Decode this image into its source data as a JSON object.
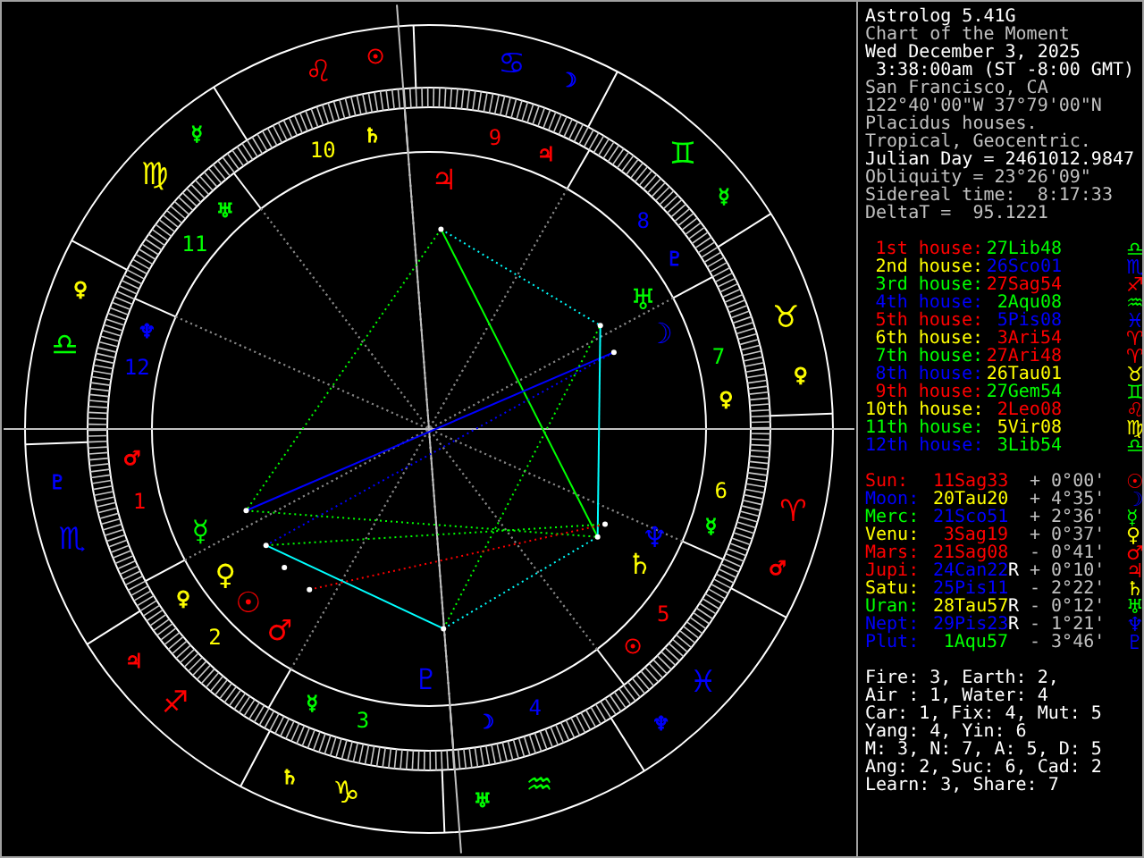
{
  "wheel": {
    "signs": [
      {
        "kind": "leo",
        "glyph": "♌",
        "color": "#ff0000",
        "ruler": {
          "glyph": "☉",
          "color": "#ff0000"
        }
      },
      {
        "kind": "cancer",
        "glyph": "♋",
        "color": "#0000ff",
        "ruler": {
          "glyph": "☽",
          "color": "#0000ff"
        }
      },
      {
        "kind": "virgo",
        "glyph": "♍",
        "color": "#ffff00",
        "ruler": {
          "glyph": "☿",
          "color": "#00ff00"
        }
      },
      {
        "kind": "gemini",
        "glyph": "♊",
        "color": "#00ff00",
        "ruler": {
          "glyph": "☿",
          "color": "#00ff00"
        }
      },
      {
        "kind": "libra",
        "glyph": "♎",
        "color": "#00ff00",
        "ruler": {
          "glyph": "♀",
          "color": "#ffff00"
        }
      },
      {
        "kind": "taurus",
        "glyph": "♉",
        "color": "#ffff00",
        "ruler": {
          "glyph": "♀",
          "color": "#ffff00"
        }
      },
      {
        "kind": "scorpio",
        "glyph": "♏",
        "color": "#0000ff",
        "ruler": {
          "glyph": "♇",
          "color": "#0000ff"
        }
      },
      {
        "kind": "aries",
        "glyph": "♈",
        "color": "#ff0000",
        "ruler": {
          "glyph": "♂",
          "color": "#ff0000"
        }
      },
      {
        "kind": "sagittarius",
        "glyph": "♐",
        "color": "#ff0000",
        "ruler": {
          "glyph": "♃",
          "color": "#ff0000"
        }
      },
      {
        "kind": "pisces",
        "glyph": "♓",
        "color": "#0000ff",
        "ruler": {
          "glyph": "♆",
          "color": "#0000ff"
        }
      },
      {
        "kind": "capricorn",
        "glyph": "♑",
        "color": "#ffff00",
        "ruler": {
          "glyph": "♄",
          "color": "#ffff00"
        }
      },
      {
        "kind": "aquarius",
        "glyph": "♒",
        "color": "#00ff00",
        "ruler": {
          "glyph": "♅",
          "color": "#00ff00"
        }
      }
    ],
    "houses": [
      {
        "kind": "tenth",
        "number": "10",
        "color": "#ffff00",
        "ruler": {
          "glyph": "♄",
          "color": "#ffff00"
        }
      },
      {
        "kind": "ninth",
        "number": "9",
        "color": "#ff0000",
        "ruler": {
          "glyph": "♃",
          "color": "#ff0000"
        }
      },
      {
        "kind": "eleventh",
        "number": "11",
        "color": "#00ff00",
        "ruler": {
          "glyph": "♅",
          "color": "#00ff00"
        }
      },
      {
        "kind": "eighth",
        "number": "8",
        "color": "#0000ff",
        "ruler": {
          "glyph": "♇",
          "color": "#0000ff"
        }
      },
      {
        "kind": "twelfth",
        "number": "12",
        "color": "#0000ff",
        "ruler": {
          "glyph": "♆",
          "color": "#0000ff"
        }
      },
      {
        "kind": "seventh",
        "number": "7",
        "color": "#00ff00",
        "ruler": {
          "glyph": "♀",
          "color": "#ffff00"
        }
      },
      {
        "kind": "first",
        "number": "1",
        "color": "#ff0000",
        "ruler": {
          "glyph": "♂",
          "color": "#ff0000"
        }
      },
      {
        "kind": "sixth",
        "number": "6",
        "color": "#ffff00",
        "ruler": {
          "glyph": "☿",
          "color": "#00ff00"
        }
      },
      {
        "kind": "second",
        "number": "2",
        "color": "#ffff00",
        "ruler": {
          "glyph": "♀",
          "color": "#ffff00"
        }
      },
      {
        "kind": "fifth",
        "number": "5",
        "color": "#ff0000",
        "ruler": {
          "glyph": "☉",
          "color": "#ff0000"
        }
      },
      {
        "kind": "third",
        "number": "3",
        "color": "#00ff00",
        "ruler": {
          "glyph": "☿",
          "color": "#00ff00"
        }
      },
      {
        "kind": "fourth",
        "number": "4",
        "color": "#0000ff",
        "ruler": {
          "glyph": "☽",
          "color": "#0000ff"
        }
      }
    ],
    "planets": [
      {
        "kind": "jupiter",
        "glyph": "♃",
        "color": "#ff0000"
      },
      {
        "kind": "uranus",
        "glyph": "♅",
        "color": "#00ff00"
      },
      {
        "kind": "moon",
        "glyph": "☽",
        "color": "#0000ff"
      },
      {
        "kind": "mercury",
        "glyph": "☿",
        "color": "#00ff00"
      },
      {
        "kind": "neptune",
        "glyph": "♆",
        "color": "#0000ff"
      },
      {
        "kind": "venus",
        "glyph": "♀",
        "color": "#ffff00"
      },
      {
        "kind": "saturn",
        "glyph": "♄",
        "color": "#ffff00"
      },
      {
        "kind": "sun",
        "glyph": "☉",
        "color": "#ff0000"
      },
      {
        "kind": "mars",
        "glyph": "♂",
        "color": "#ff0000"
      },
      {
        "kind": "pluto",
        "glyph": "♇",
        "color": "#0000ff"
      }
    ]
  },
  "info": [
    {
      "text": "Astrolog 5.41G",
      "color": "#ffffff"
    },
    {
      "text": "Chart of the Moment",
      "color": "#c0c0c0"
    },
    {
      "text": "Wed December 3, 2025",
      "color": "#ffffff"
    },
    {
      "text": " 3:38:00am (ST -8:00 GMT)",
      "color": "#ffffff"
    },
    {
      "text": "San Francisco, CA",
      "color": "#c0c0c0"
    },
    {
      "text": "122°40'00\"W 37°79'00\"N",
      "color": "#c0c0c0"
    },
    {
      "text": "Placidus houses.",
      "color": "#c0c0c0"
    },
    {
      "text": "Tropical, Geocentric.",
      "color": "#c0c0c0"
    },
    {
      "text": "Julian Day = 2461012.9847",
      "color": "#ffffff"
    },
    {
      "text": "Obliquity = 23°26'09\"",
      "color": "#c0c0c0"
    },
    {
      "text": "Sidereal time:  8:17:33",
      "color": "#c0c0c0"
    },
    {
      "text": "DeltaT =  95.1221",
      "color": "#c0c0c0"
    }
  ],
  "houses": [
    {
      "label": "1st house:",
      "color": "#ff0000",
      "cusp": {
        "text": "27Lib48",
        "color": "#00ff00"
      },
      "glyph": "♎"
    },
    {
      "label": "2nd house:",
      "color": "#ffff00",
      "cusp": {
        "text": "26Sco01",
        "color": "#0000ff"
      },
      "glyph": "♏"
    },
    {
      "label": "3rd house:",
      "color": "#00ff00",
      "cusp": {
        "text": "27Sag54",
        "color": "#ff0000"
      },
      "glyph": "♐"
    },
    {
      "label": "4th house:",
      "color": "#0000ff",
      "cusp": {
        "text": "2Aqu08",
        "color": "#00ff00"
      },
      "glyph": "♒"
    },
    {
      "label": "5th house:",
      "color": "#ff0000",
      "cusp": {
        "text": "5Pis08",
        "color": "#0000ff"
      },
      "glyph": "♓"
    },
    {
      "label": "6th house:",
      "color": "#ffff00",
      "cusp": {
        "text": "3Ari54",
        "color": "#ff0000"
      },
      "glyph": "♈"
    },
    {
      "label": "7th house:",
      "color": "#00ff00",
      "cusp": {
        "text": "27Ari48",
        "color": "#ff0000"
      },
      "glyph": "♈"
    },
    {
      "label": "8th house:",
      "color": "#0000ff",
      "cusp": {
        "text": "26Tau01",
        "color": "#ffff00"
      },
      "glyph": "♉"
    },
    {
      "label": "9th house:",
      "color": "#ff0000",
      "cusp": {
        "text": "27Gem54",
        "color": "#00ff00"
      },
      "glyph": "♊"
    },
    {
      "label": "10th house:",
      "color": "#ffff00",
      "cusp": {
        "text": "2Leo08",
        "color": "#ff0000"
      },
      "glyph": "♌"
    },
    {
      "label": "11th house:",
      "color": "#00ff00",
      "cusp": {
        "text": "5Vir08",
        "color": "#ffff00"
      },
      "glyph": "♍"
    },
    {
      "label": "12th house:",
      "color": "#0000ff",
      "cusp": {
        "text": "3Lib54",
        "color": "#00ff00"
      },
      "glyph": "♎"
    }
  ],
  "planets": [
    {
      "name": "Sun:",
      "color": "#ff0000",
      "position": {
        "text": "11Sag33",
        "color": "#ff0000"
      },
      "latitude": "+ 0°00'",
      "glyph": "☉"
    },
    {
      "name": "Moon:",
      "color": "#0000ff",
      "position": {
        "text": "20Tau20",
        "color": "#ffff00"
      },
      "latitude": "+ 4°35'",
      "glyph": "☽"
    },
    {
      "name": "Merc:",
      "color": "#00ff00",
      "position": {
        "text": "21Sco51",
        "color": "#0000ff"
      },
      "latitude": "+ 2°36'",
      "glyph": "☿"
    },
    {
      "name": "Venu:",
      "color": "#ffff00",
      "position": {
        "text": "3Sag19",
        "color": "#ff0000"
      },
      "latitude": "+ 0°37'",
      "glyph": "♀"
    },
    {
      "name": "Mars:",
      "color": "#ff0000",
      "position": {
        "text": "21Sag08",
        "color": "#ff0000"
      },
      "latitude": "- 0°41'",
      "glyph": "♂"
    },
    {
      "name": "Jupi:",
      "color": "#ff0000",
      "position": {
        "text": "24Can22",
        "color": "#0000ff"
      },
      "retrograde_mark": "R",
      "latitude": "+ 0°10'",
      "glyph": "♃"
    },
    {
      "name": "Satu:",
      "color": "#ffff00",
      "position": {
        "text": "25Pis11",
        "color": "#0000ff"
      },
      "latitude": "- 2°22'",
      "glyph": "♄"
    },
    {
      "name": "Uran:",
      "color": "#00ff00",
      "position": {
        "text": "28Tau57",
        "color": "#ffff00"
      },
      "retrograde_mark": "R",
      "latitude": "- 0°12'",
      "glyph": "♅"
    },
    {
      "name": "Nept:",
      "color": "#0000ff",
      "position": {
        "text": "29Pis23",
        "color": "#0000ff"
      },
      "retrograde_mark": "R",
      "latitude": "- 1°21'",
      "glyph": "♆"
    },
    {
      "name": "Plut:",
      "color": "#0000ff",
      "position": {
        "text": "1Aqu57",
        "color": "#00ff00"
      },
      "latitude": "- 3°46'",
      "glyph": "♇"
    }
  ],
  "summary": [
    "Fire: 3, Earth: 2,",
    "Air : 1, Water: 4",
    "Car: 1, Fix: 4, Mut: 5",
    "Yang: 4, Yin: 6",
    "M: 3, N: 7, A: 5, D: 5",
    "Ang: 2, Suc: 6, Cad: 2",
    "Learn: 3, Share: 7"
  ]
}
